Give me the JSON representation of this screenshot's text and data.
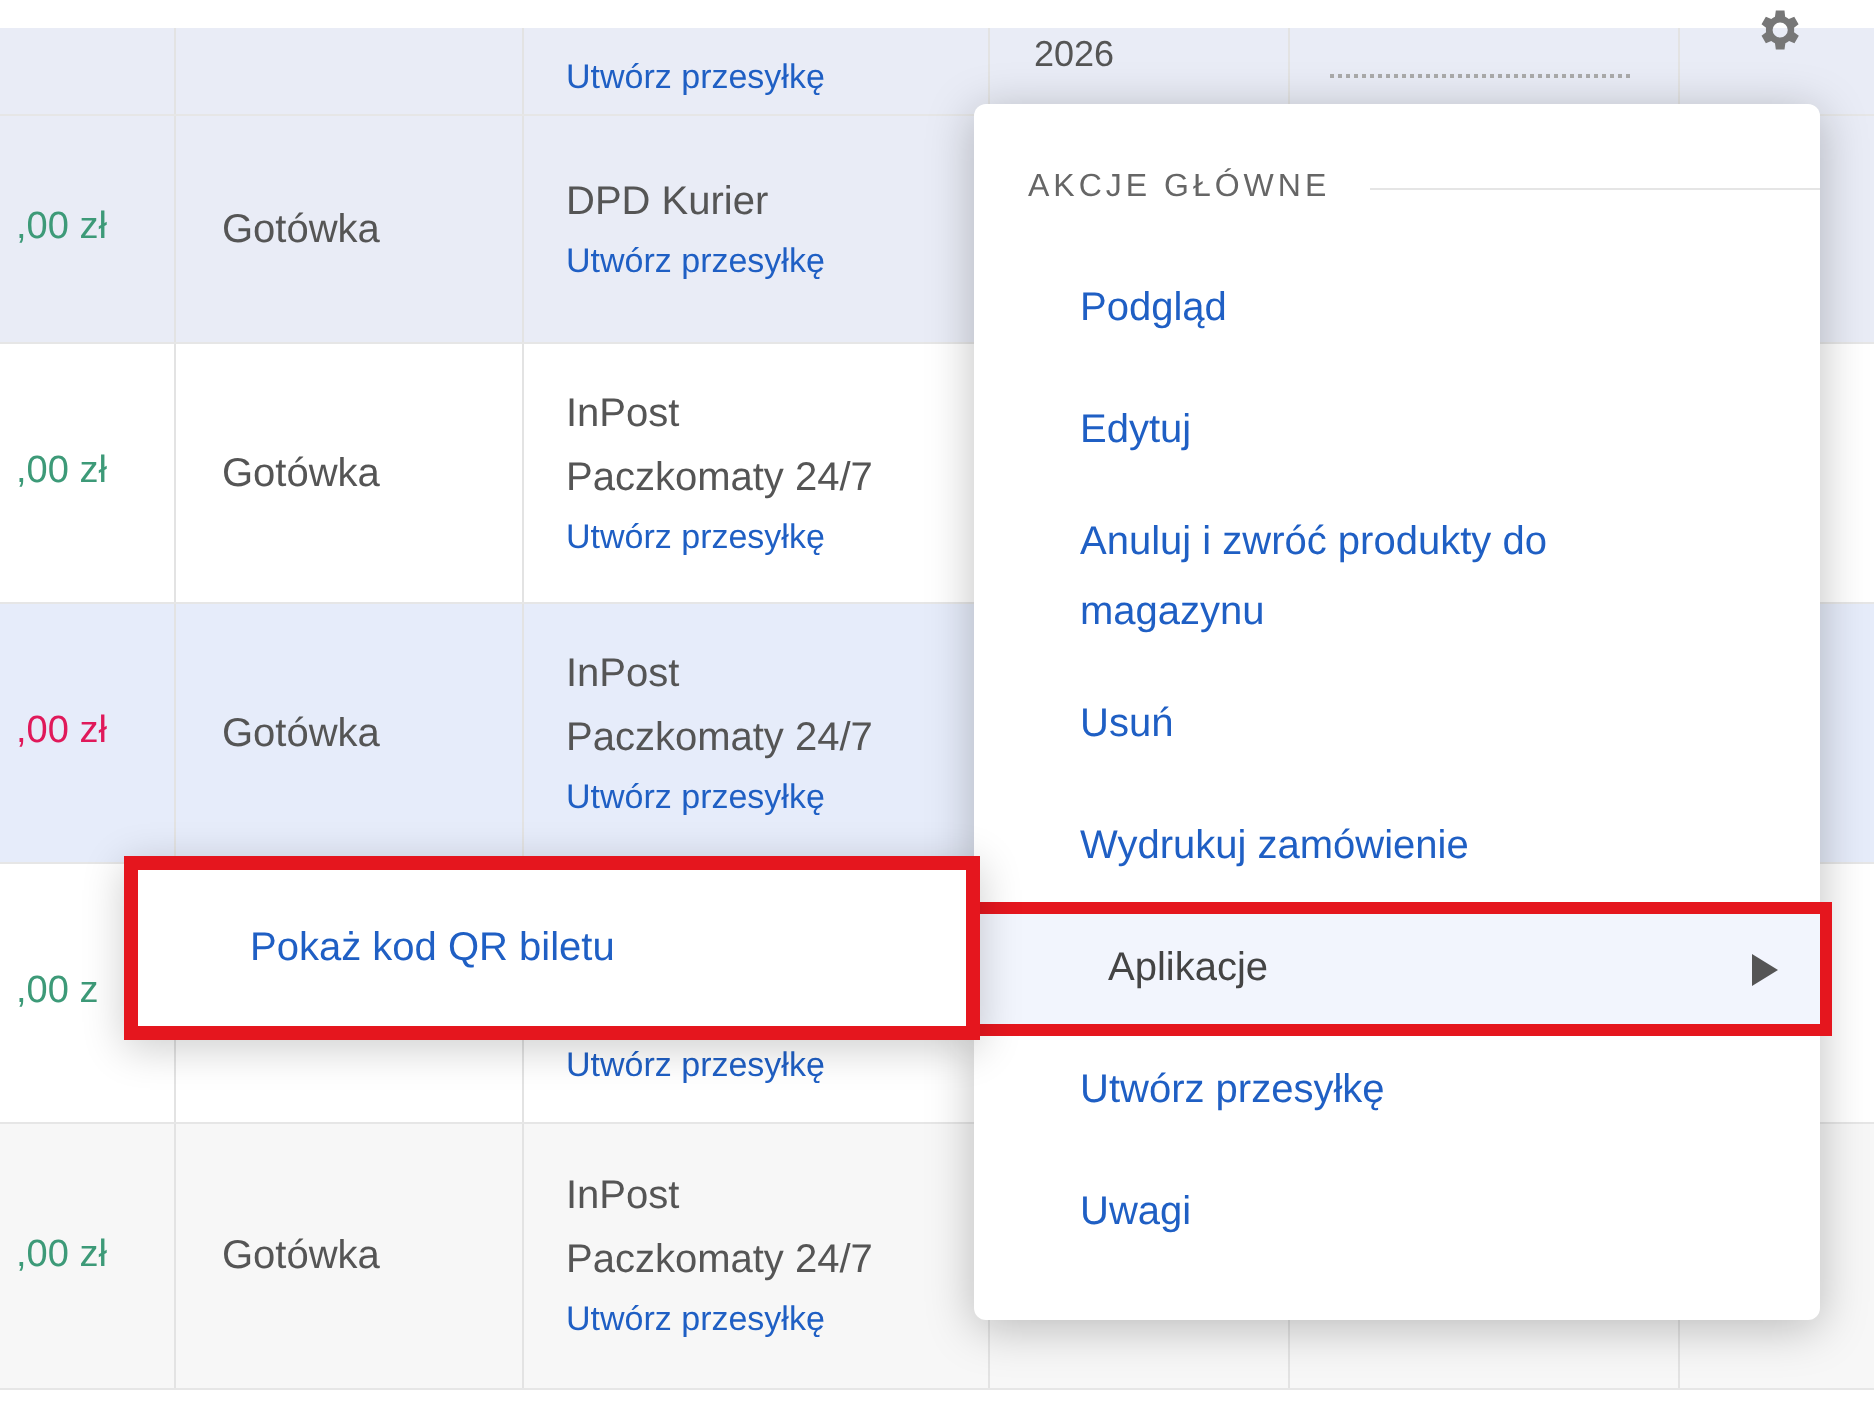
{
  "table": {
    "rows": [
      {
        "action": "Utwórz przesyłkę",
        "date": "2026",
        "highlighted": true
      },
      {
        "amount": ",00 zł",
        "color": "#3d9a78",
        "payment": "Gotówka",
        "carrier": [
          "DPD Kurier"
        ],
        "action": "Utwórz przesyłkę",
        "highlighted": true
      },
      {
        "amount": ",00 zł",
        "color": "#3d9a78",
        "payment": "Gotówka",
        "carrier": [
          "InPost",
          "Paczkomaty 24/7"
        ],
        "action": "Utwórz przesyłkę",
        "highlighted": false
      },
      {
        "amount": ",00 zł",
        "color": "#e0195a",
        "payment": "Gotówka",
        "carrier": [
          "InPost",
          "Paczkomaty 24/7"
        ],
        "action": "Utwórz przesyłkę",
        "highlighted": true
      },
      {
        "amount": ",00 z",
        "color": "#3d9a78",
        "action": "Utwórz przesyłkę",
        "highlighted": false
      },
      {
        "amount": ",00 zł",
        "color": "#3d9a78",
        "payment": "Gotówka",
        "carrier": [
          "InPost",
          "Paczkomaty 24/7"
        ],
        "action": "Utwórz przesyłkę",
        "highlighted": false
      }
    ]
  },
  "menu": {
    "heading": "AKCJE GŁÓWNE",
    "items": [
      {
        "label": "Podgląd",
        "kind": "link",
        "selected": false,
        "annotated": false
      },
      {
        "label": "Edytuj",
        "kind": "link",
        "selected": false,
        "annotated": false
      },
      {
        "label": "Anuluj i zwróć produkty do magazynu",
        "kind": "link",
        "selected": false,
        "annotated": false
      },
      {
        "label": "Usuń",
        "kind": "link",
        "selected": false,
        "annotated": false
      },
      {
        "label": "Wydrukuj zamówienie",
        "kind": "link",
        "selected": false,
        "annotated": false
      },
      {
        "label": "Aplikacje",
        "kind": "submenu",
        "selected": true,
        "annotated": true
      },
      {
        "label": "Utwórz przesyłkę",
        "kind": "link",
        "selected": false,
        "annotated": false
      },
      {
        "label": "Uwagi",
        "kind": "link",
        "selected": false,
        "annotated": false
      }
    ]
  },
  "submenu": {
    "items": [
      {
        "label": "Pokaż kod QR biletu",
        "annotated": true
      }
    ]
  }
}
